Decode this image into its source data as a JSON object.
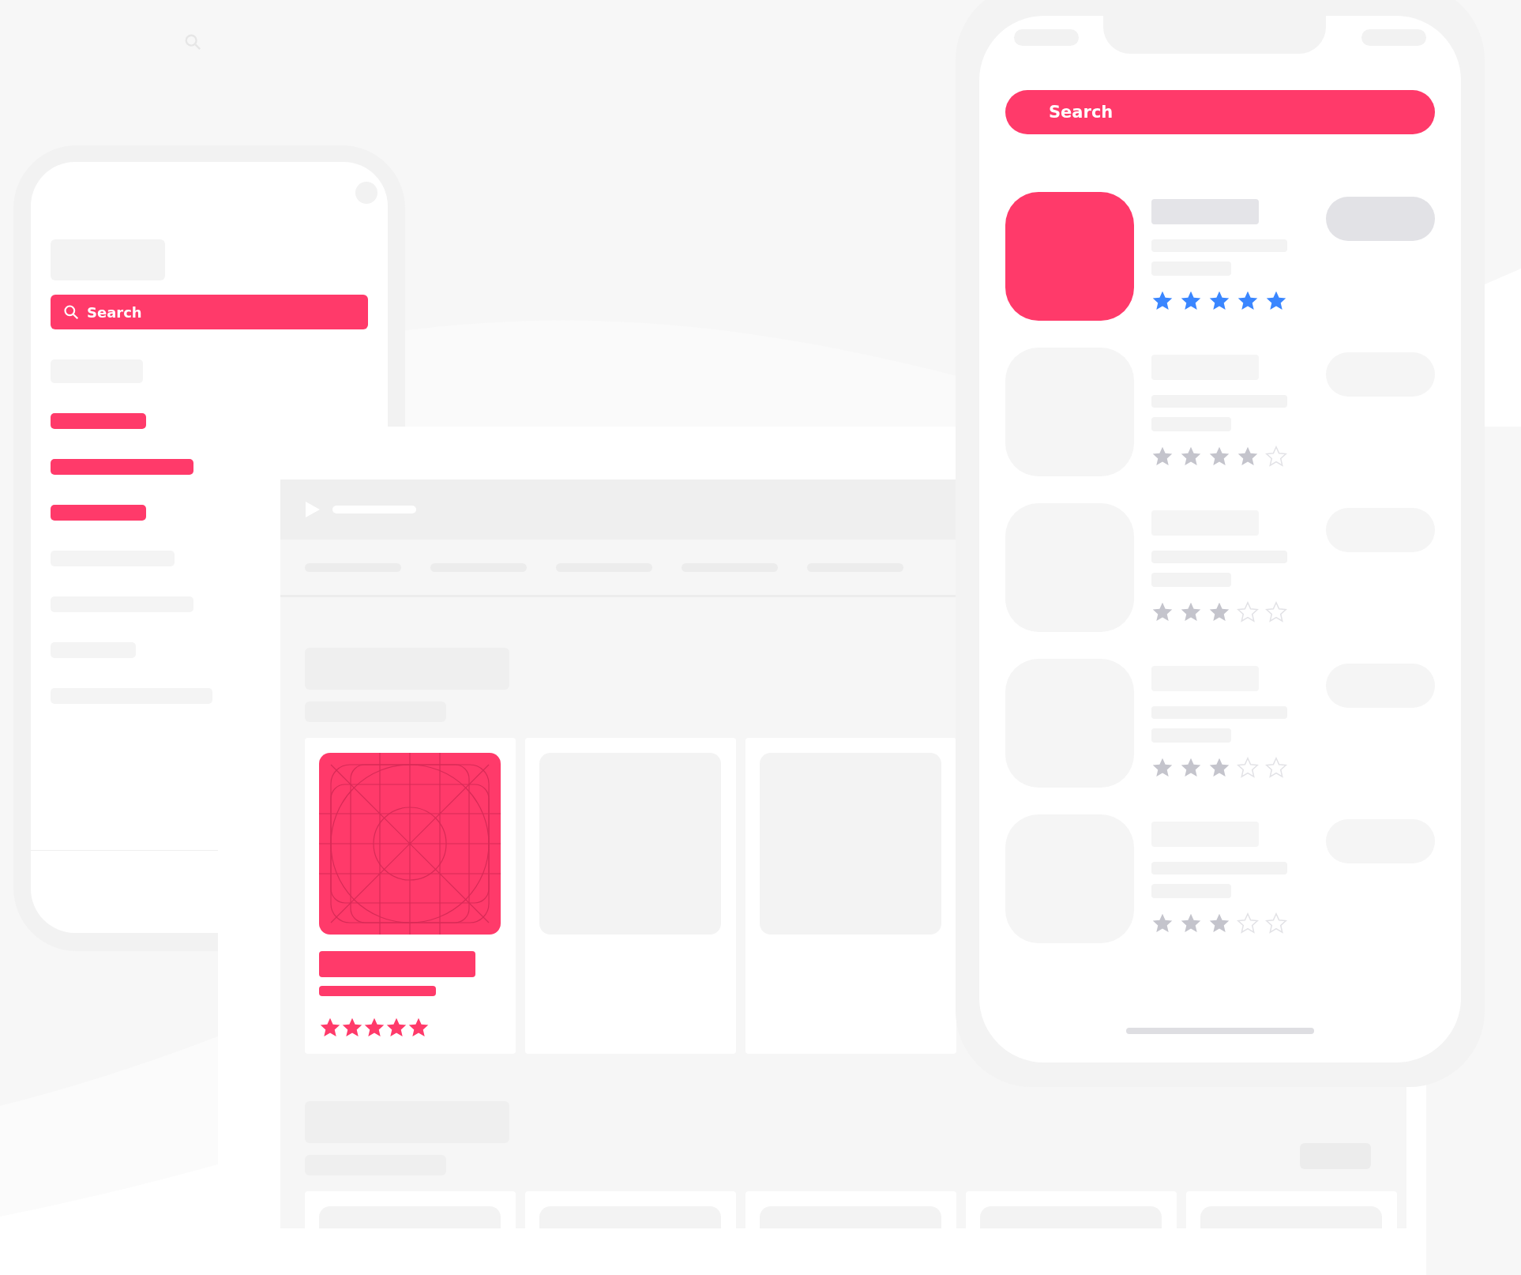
{
  "left_phone": {
    "search": {
      "label": "Search"
    },
    "menu": [
      {
        "selected": false
      },
      {
        "selected": true
      },
      {
        "selected": true
      },
      {
        "selected": true
      },
      {
        "selected": false
      },
      {
        "selected": false
      },
      {
        "selected": false
      },
      {
        "selected": false
      }
    ]
  },
  "tablet": {
    "sections": [
      {
        "cards": [
          {
            "selected": true,
            "stars": 5
          },
          {
            "selected": false
          },
          {
            "selected": false
          }
        ]
      },
      {
        "cards": [
          {
            "selected": false
          },
          {
            "selected": false
          },
          {
            "selected": false
          },
          {
            "selected": false
          },
          {
            "selected": false
          }
        ]
      }
    ]
  },
  "right_phone": {
    "search": {
      "label": "Search"
    },
    "apps": [
      {
        "selected": true,
        "stars": 5
      },
      {
        "selected": false,
        "stars": 4
      },
      {
        "selected": false,
        "stars": 3
      },
      {
        "selected": false,
        "stars": 3
      },
      {
        "selected": false,
        "stars": 3
      }
    ]
  }
}
